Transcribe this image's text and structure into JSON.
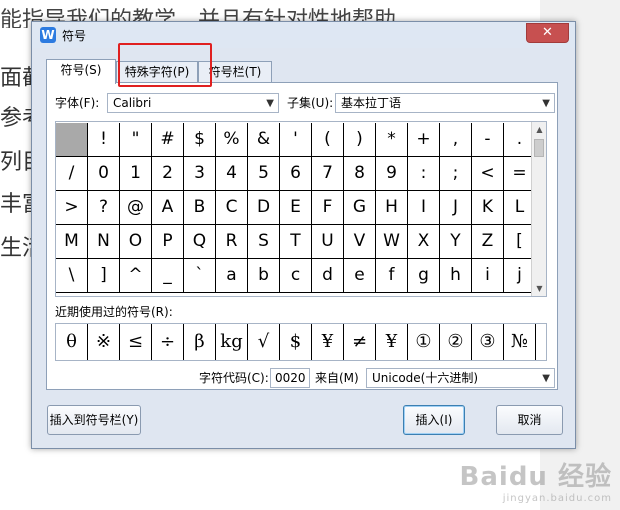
{
  "background_document": {
    "top_line": "能指导我们的教学，并且有针对性地帮助",
    "side_lines": [
      "面截",
      "参考",
      "列目",
      "丰富",
      "生活"
    ]
  },
  "dialog": {
    "title": "符号",
    "app_icon_letter": "W",
    "close_glyph": "✕",
    "tabs": [
      "符号(S)",
      "特殊字符(P)",
      "符号栏(T)"
    ],
    "font_label": "字体(F):",
    "font_value": "Calibri",
    "subset_label": "子集(U):",
    "subset_value": "基本拉丁语",
    "symbols": [
      [
        " ",
        "!",
        "\"",
        "#",
        "$",
        "%",
        "&",
        "'",
        "(",
        ")",
        "*",
        "+",
        ",",
        "-",
        "."
      ],
      [
        "/",
        "0",
        "1",
        "2",
        "3",
        "4",
        "5",
        "6",
        "7",
        "8",
        "9",
        ":",
        ";",
        "<",
        "="
      ],
      [
        ">",
        "?",
        "@",
        "A",
        "B",
        "C",
        "D",
        "E",
        "F",
        "G",
        "H",
        "I",
        "J",
        "K",
        "L"
      ],
      [
        "M",
        "N",
        "O",
        "P",
        "Q",
        "R",
        "S",
        "T",
        "U",
        "V",
        "W",
        "X",
        "Y",
        "Z",
        "["
      ],
      [
        "\\",
        "]",
        "^",
        "_",
        "`",
        "a",
        "b",
        "c",
        "d",
        "e",
        "f",
        "g",
        "h",
        "i",
        "j"
      ]
    ],
    "recent_label": "近期使用过的符号(R):",
    "recent_symbols": [
      "θ",
      "※",
      "≤",
      "÷",
      "β",
      "kg",
      "√",
      "$",
      "¥",
      "≠",
      "¥",
      "①",
      "②",
      "③",
      "№"
    ],
    "char_code_label": "字符代码(C):",
    "char_code_value": "0020",
    "from_label": "来自(M)",
    "from_value": "Unicode(十六进制)",
    "insert_to_bar_button": "插入到符号栏(Y)",
    "insert_button": "插入(I)",
    "cancel_button": "取消"
  },
  "watermark": {
    "line1": "Baidu 经验",
    "line2": "jingyan.baidu.com"
  },
  "colors": {
    "highlight_box": "#e02020",
    "selected_cell": "#a9a9a9",
    "dialog_bg": "#dfe6f1",
    "close_button": "#c75050"
  }
}
